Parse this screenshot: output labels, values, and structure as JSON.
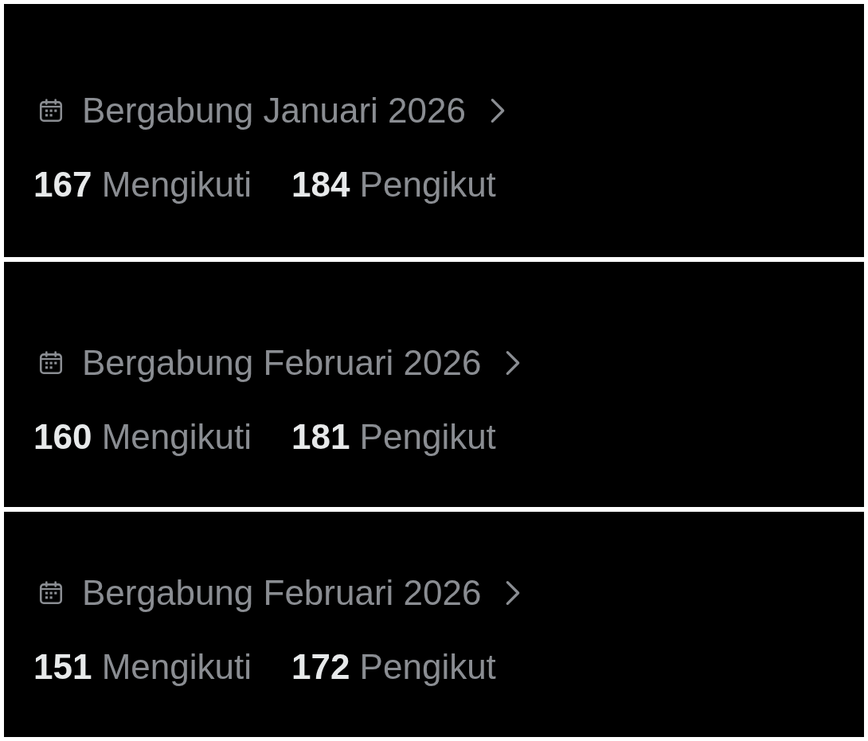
{
  "profiles": [
    {
      "joined": "Bergabung Januari 2026",
      "stats": [
        {
          "count": "167",
          "label": "Mengikuti"
        },
        {
          "count": "184",
          "label": "Pengikut"
        }
      ]
    },
    {
      "joined": "Bergabung Februari 2026",
      "stats": [
        {
          "count": "160",
          "label": "Mengikuti"
        },
        {
          "count": "181",
          "label": "Pengikut"
        }
      ]
    },
    {
      "joined": "Bergabung Februari 2026",
      "stats": [
        {
          "count": "151",
          "label": "Mengikuti"
        },
        {
          "count": "172",
          "label": "Pengikut"
        }
      ]
    }
  ]
}
